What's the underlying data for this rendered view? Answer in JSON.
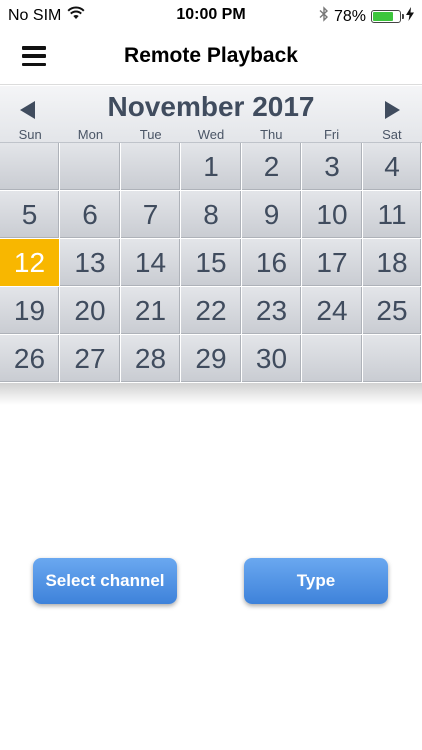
{
  "status_bar": {
    "carrier": "No SIM",
    "time": "10:00 PM",
    "battery_text": "78%",
    "battery_level": 0.78,
    "battery_color": "#3cc53c"
  },
  "nav": {
    "title": "Remote Playback"
  },
  "calendar": {
    "month_title": "November 2017",
    "weekdays": [
      "Sun",
      "Mon",
      "Tue",
      "Wed",
      "Thu",
      "Fri",
      "Sat"
    ],
    "leading_blanks": 3,
    "days": [
      "1",
      "2",
      "3",
      "4",
      "5",
      "6",
      "7",
      "8",
      "9",
      "10",
      "11",
      "12",
      "13",
      "14",
      "15",
      "16",
      "17",
      "18",
      "19",
      "20",
      "21",
      "22",
      "23",
      "24",
      "25",
      "26",
      "27",
      "28",
      "29",
      "30"
    ],
    "trailing_blanks": 2,
    "selected_day": "12",
    "selected_color": "#f8b700"
  },
  "buttons": {
    "select_channel": "Select channel",
    "type": "Type"
  }
}
